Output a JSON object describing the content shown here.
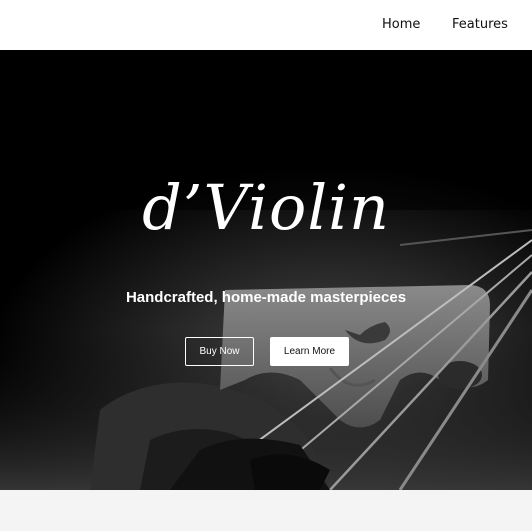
{
  "nav": {
    "links": [
      {
        "label": "Home"
      },
      {
        "label": "Features"
      }
    ]
  },
  "hero": {
    "logo": "d’Violin",
    "tagline": "Handcrafted, home-made masterpieces",
    "buttons": {
      "buy_label": "Buy Now",
      "learn_label": "Learn More"
    }
  },
  "colors": {
    "nav_bg": "#ffffff",
    "hero_bg": "#000000",
    "page_bg": "#f4f4f4",
    "accent": "#ffffff"
  }
}
